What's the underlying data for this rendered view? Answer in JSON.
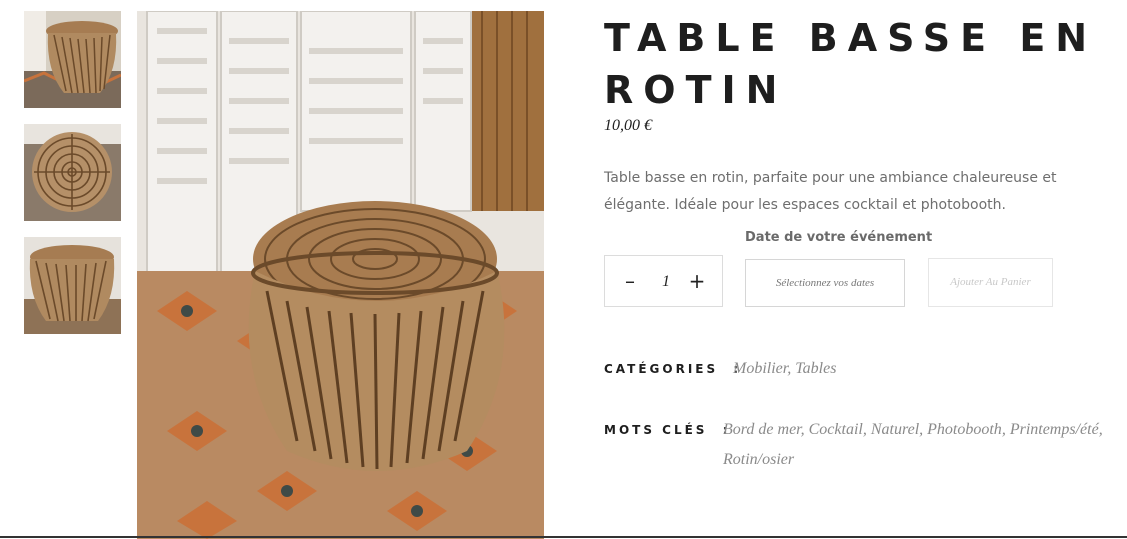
{
  "product": {
    "title": "TABLE BASSE EN ROTIN",
    "price": "10,00 €",
    "description": "Table basse en rotin, parfaite pour une ambiance chaleureuse et élégante. Idéale pour les espaces cocktail et photobooth."
  },
  "gallery": {
    "thumbnails": [
      "rattan-table-side-view",
      "rattan-table-top-view",
      "rattan-table-front-view"
    ],
    "main_image": "rattan-table-on-rug-with-screen"
  },
  "booking": {
    "event_label": "Date de votre événement",
    "quantity": "1",
    "minus_symbol": "–",
    "plus_symbol": "+",
    "date_button": "Sélectionnez vos dates",
    "cart_button": "Ajouter Au Panier"
  },
  "meta": {
    "categories_label": "CATÉGORIES",
    "categories": [
      "Mobilier",
      "Tables"
    ],
    "tags_label": "MOTS CLÉS",
    "tags": [
      "Bord de mer",
      "Cocktail",
      "Naturel",
      "Photobooth",
      "Printemps/été",
      "Rotin/osier"
    ],
    "separator": ":"
  },
  "colors": {
    "title": "#1e1e1e",
    "muted_text": "#6e6e6e",
    "rattan": "#a67c52",
    "rug_orange": "#c8733c"
  }
}
